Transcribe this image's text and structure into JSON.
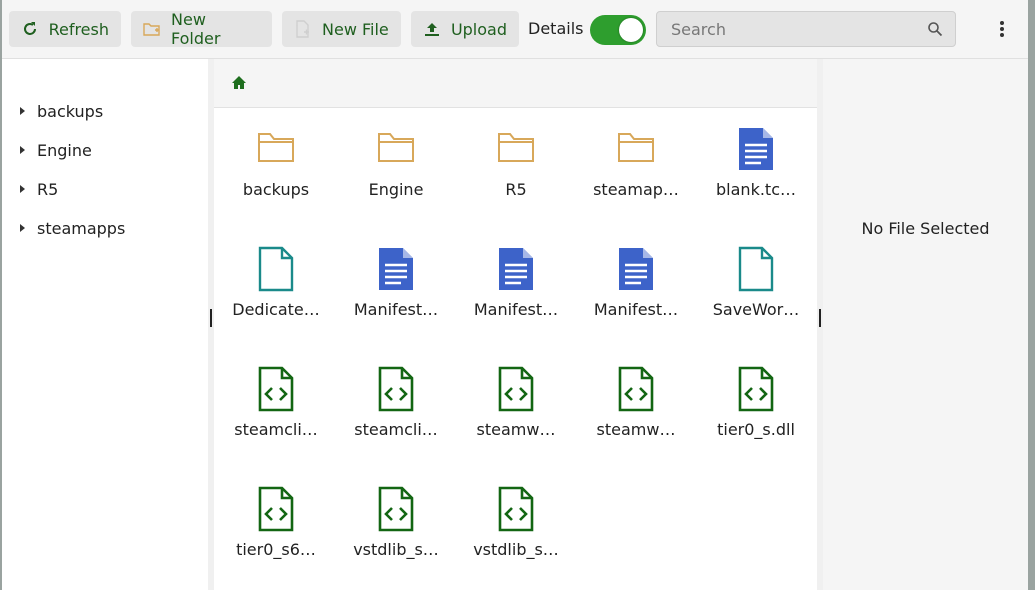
{
  "toolbar": {
    "refresh": "Refresh",
    "new_folder": "New Folder",
    "new_file": "New File",
    "upload": "Upload",
    "details_label": "Details",
    "details_on": true,
    "search_placeholder": "Search"
  },
  "tree": {
    "items": [
      {
        "label": "backups"
      },
      {
        "label": "Engine"
      },
      {
        "label": "R5"
      },
      {
        "label": "steamapps"
      }
    ]
  },
  "files": [
    {
      "name": "backups",
      "type": "folder"
    },
    {
      "name": "Engine",
      "type": "folder"
    },
    {
      "name": "R5",
      "type": "folder"
    },
    {
      "name": "steamap…",
      "type": "folder"
    },
    {
      "name": "blank.tc…",
      "type": "text"
    },
    {
      "name": "Dedicate…",
      "type": "file"
    },
    {
      "name": "Manifest…",
      "type": "text"
    },
    {
      "name": "Manifest…",
      "type": "text"
    },
    {
      "name": "Manifest…",
      "type": "text"
    },
    {
      "name": "SaveWor…",
      "type": "file"
    },
    {
      "name": "steamcli…",
      "type": "code"
    },
    {
      "name": "steamcli…",
      "type": "code"
    },
    {
      "name": "steamw…",
      "type": "code"
    },
    {
      "name": "steamw…",
      "type": "code"
    },
    {
      "name": "tier0_s.dll",
      "type": "code"
    },
    {
      "name": "tier0_s6…",
      "type": "code"
    },
    {
      "name": "vstdlib_s…",
      "type": "code"
    },
    {
      "name": "vstdlib_s…",
      "type": "code"
    }
  ],
  "detail": {
    "empty_text": "No File Selected"
  },
  "colors": {
    "accent": "#2e9e2e",
    "folder": "#d8a85a",
    "text_doc": "#3d63c9",
    "plain_file": "#1a8a8a",
    "code_file": "#136613"
  }
}
